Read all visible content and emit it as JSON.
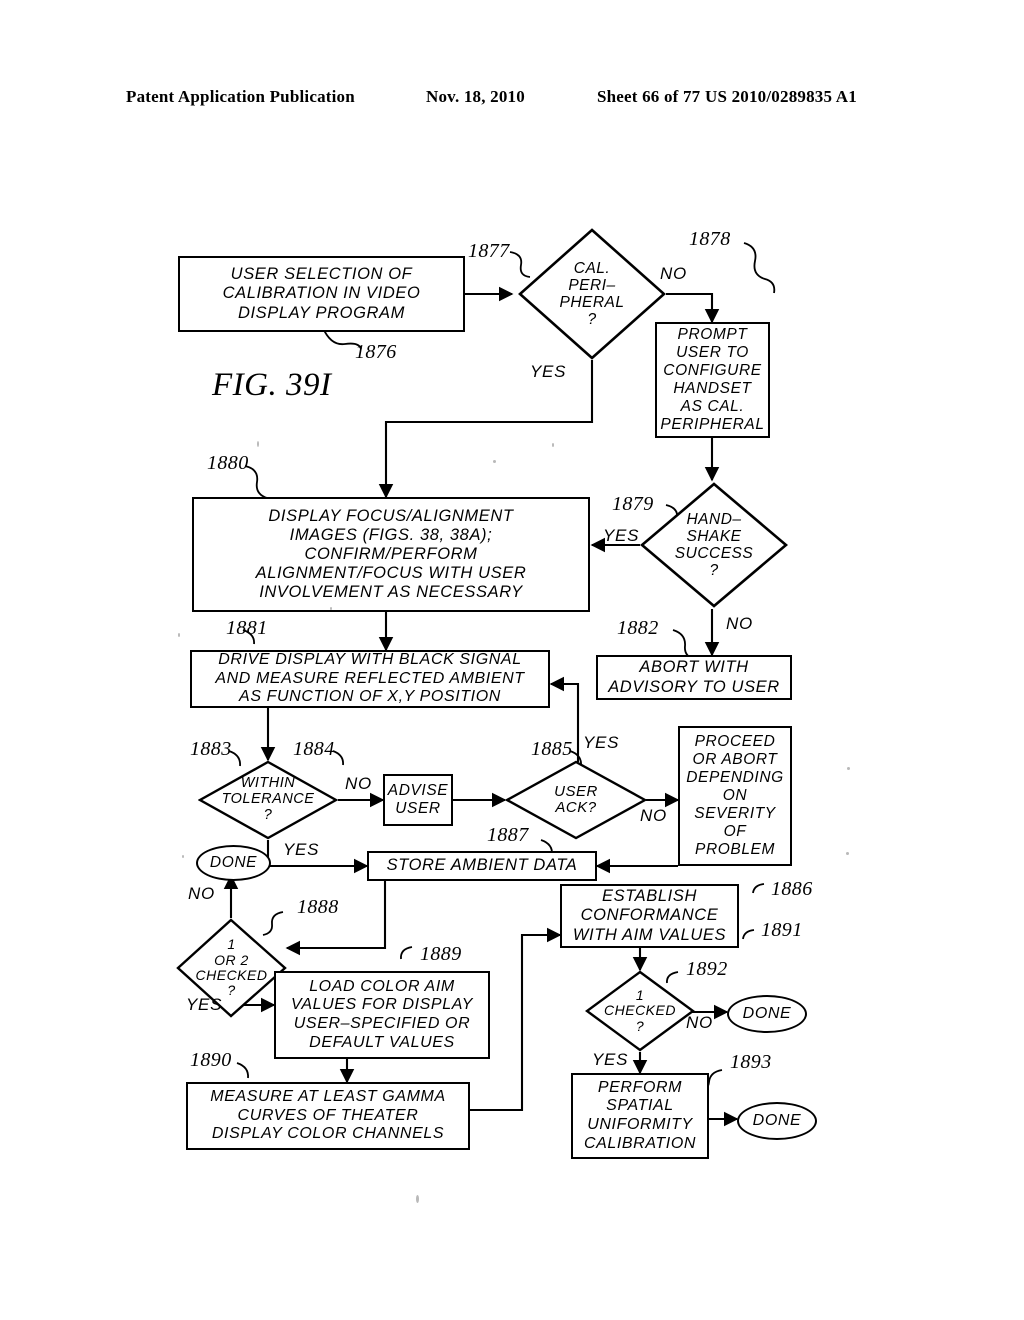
{
  "header": {
    "publication": "Patent Application Publication",
    "date": "Nov. 18, 2010",
    "sheet": "Sheet 66 of 77",
    "number": "US 2010/0289835 A1"
  },
  "figure": {
    "caption": "FIG. 39I"
  },
  "nodes": {
    "user_selection": {
      "id": "1876",
      "type": "process",
      "text": "USER  SELECTION  OF\nCALIBRATION  IN  VIDEO\nDISPLAY  PROGRAM"
    },
    "cal_peripheral": {
      "id": "1877",
      "type": "decision",
      "text": "CAL.\nPERI–\nPHERAL\n?"
    },
    "prompt_user": {
      "id": "1878",
      "type": "process",
      "text": "PROMPT\nUSER  TO\nCONFIGURE\nHANDSET\nAS  CAL.\nPERIPHERAL"
    },
    "handshake": {
      "id": "1879",
      "type": "decision",
      "text": "HAND–\nSHAKE\nSUCCESS\n?"
    },
    "display_focus": {
      "id": "1880",
      "type": "process",
      "text": "DISPLAY  FOCUS/ALIGNMENT\nIMAGES  (FIGS.  38,  38A);\nCONFIRM/PERFORM\nALIGNMENT/FOCUS  WITH  USER\nINVOLVEMENT  AS  NECESSARY"
    },
    "drive_display": {
      "id": "1881",
      "type": "process",
      "text": "DRIVE DISPLAY WITH BLACK SIGNAL\nAND MEASURE REFLECTED AMBIENT\nAS FUNCTION OF X,Y POSITION"
    },
    "abort_advisory": {
      "id": "1882",
      "type": "process",
      "text": "ABORT  WITH\nADVISORY  TO  USER"
    },
    "within_tolerance": {
      "id": "1883",
      "type": "decision",
      "text": "WITHIN\nTOLERANCE\n?"
    },
    "advise_user": {
      "id": "1884",
      "type": "process",
      "text": "ADVISE\nUSER"
    },
    "user_ack": {
      "id": "1885",
      "type": "decision",
      "text": "USER\nACK?"
    },
    "proceed_or_abort": {
      "id": "1886",
      "type": "process",
      "text": "PROCEED\nOR  ABORT\nDEPENDING\nON\nSEVERITY\nOF\nPROBLEM"
    },
    "store_ambient": {
      "id": "1887",
      "type": "process",
      "text": "STORE  AMBIENT  DATA"
    },
    "one_or_two_checked": {
      "id": "1888",
      "type": "decision",
      "text": "1\nOR  2\nCHECKED\n?"
    },
    "load_color_aim": {
      "id": "1889",
      "type": "process",
      "text": "LOAD  COLOR  AIM\nVALUES  FOR  DISPLAY\nUSER–SPECIFIED  OR\nDEFAULT  VALUES"
    },
    "measure_gamma": {
      "id": "1890",
      "type": "process",
      "text": "MEASURE  AT  LEAST  GAMMA\nCURVES  OF  THEATER\nDISPLAY  COLOR  CHANNELS"
    },
    "establish_conformance": {
      "id": "1891",
      "type": "process",
      "text": "ESTABLISH\nCONFORMANCE\nWITH  AIM  VALUES"
    },
    "one_checked": {
      "id": "1892",
      "type": "decision",
      "text": "1\nCHECKED\n?"
    },
    "perform_spatial": {
      "id": "1893",
      "type": "process",
      "text": "PERFORM\nSPATIAL\nUNIFORMITY\nCALIBRATION"
    },
    "done_tolerance": {
      "type": "terminator",
      "text": "DONE"
    },
    "done_one_checked": {
      "type": "terminator",
      "text": "DONE"
    },
    "done_spatial": {
      "type": "terminator",
      "text": "DONE"
    }
  },
  "edge_labels": {
    "cal_no": "NO",
    "cal_yes": "YES",
    "handshake_yes": "YES",
    "handshake_no": "NO",
    "tolerance_no": "NO",
    "tolerance_yes": "YES",
    "ack_yes": "YES",
    "ack_no": "NO",
    "checked12_no": "NO",
    "checked12_yes": "YES",
    "checked1_no": "NO",
    "checked1_yes": "YES"
  },
  "colors": {
    "ink": "#000000",
    "paper": "#ffffff"
  }
}
